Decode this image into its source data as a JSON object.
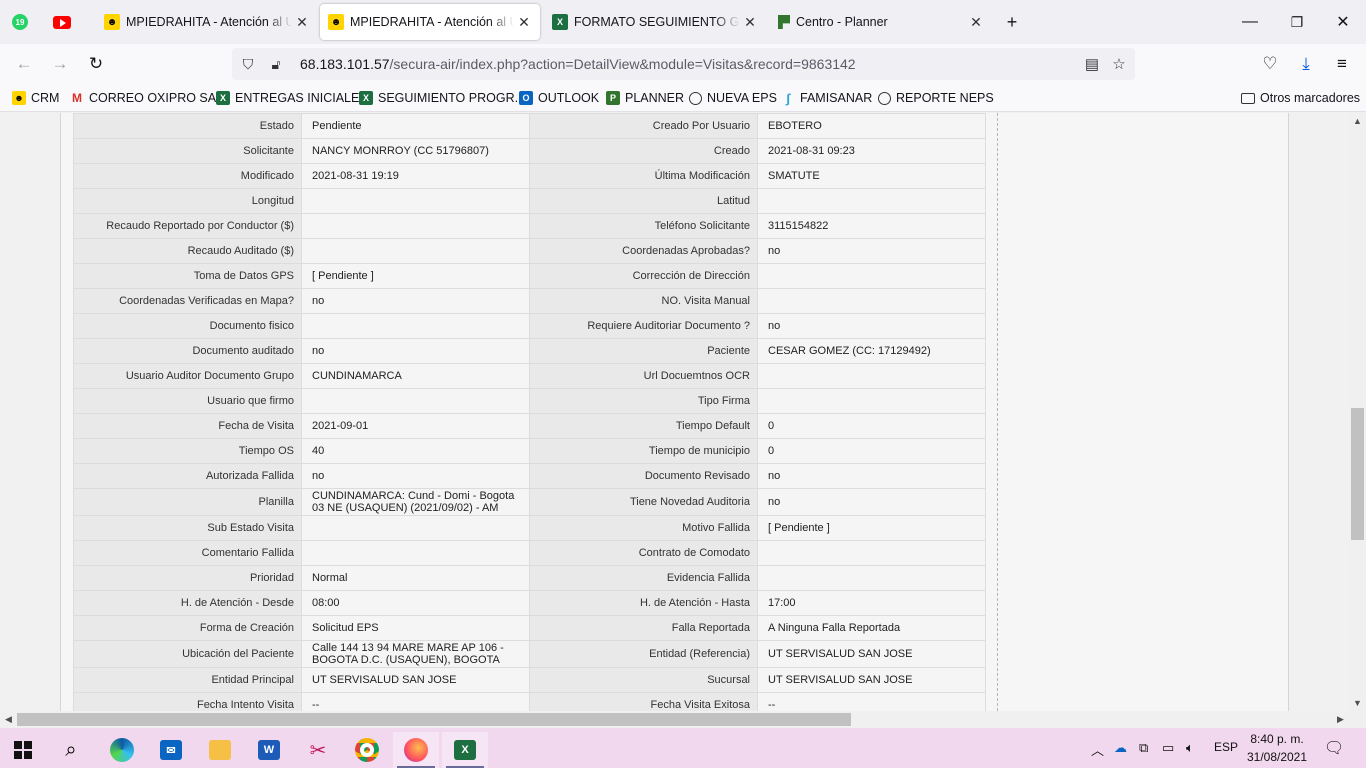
{
  "browser": {
    "pinned": [
      {
        "name": "whatsapp",
        "badge": "19"
      },
      {
        "name": "youtube"
      }
    ],
    "tabs": [
      {
        "title": "MPIEDRAHITA - Atención al Usuario",
        "active": false
      },
      {
        "title": "MPIEDRAHITA - Atención al Usuario",
        "active": true
      },
      {
        "title": "FORMATO SEGUIMIENTO GD.xlsx",
        "active": false
      },
      {
        "title": "Centro - Planner",
        "active": false
      }
    ],
    "url_host": "68.183.101.57",
    "url_path": "/secura-air/index.php?action=DetailView&module=Visitas&record=9863142",
    "bookmarks": [
      {
        "label": "CRM",
        "icon": "crm-icon"
      },
      {
        "label": "CORREO OXIPRO SAS",
        "icon": "gmail-icon"
      },
      {
        "label": "ENTREGAS INICIALES",
        "icon": "excel-icon"
      },
      {
        "label": "SEGUIMIENTO PROGR...",
        "icon": "excel-icon"
      },
      {
        "label": "OUTLOOK",
        "icon": "outlook-icon"
      },
      {
        "label": "PLANNER",
        "icon": "planner-icon"
      },
      {
        "label": "NUEVA EPS",
        "icon": "globe-icon"
      },
      {
        "label": "FAMISANAR",
        "icon": "famisanar-icon"
      },
      {
        "label": "REPORTE NEPS",
        "icon": "globe-icon"
      }
    ],
    "other_bookmarks": "Otros marcadores"
  },
  "detail": {
    "rows": [
      {
        "l1": "Estado",
        "v1": "Pendiente",
        "l2": "Creado Por Usuario",
        "v2": "EBOTERO"
      },
      {
        "l1": "Solicitante",
        "v1": "NANCY MONRROY (CC 51796807)",
        "l2": "Creado",
        "v2": "2021-08-31 09:23"
      },
      {
        "l1": "Modificado",
        "v1": "2021-08-31 19:19",
        "l2": "Última Modificación",
        "v2": " SMATUTE"
      },
      {
        "l1": "Longitud",
        "v1": "",
        "l2": "Latitud",
        "v2": ""
      },
      {
        "l1": "Recaudo Reportado por Conductor ($)",
        "v1": "",
        "l2": "Teléfono Solicitante",
        "v2": "3115154822"
      },
      {
        "l1": "Recaudo Auditado ($)",
        "v1": "",
        "l2": "Coordenadas Aprobadas?",
        "v2": " no"
      },
      {
        "l1": "Toma de Datos GPS",
        "v1": "[ Pendiente ]",
        "l2": "Corrección de Dirección",
        "v2": ""
      },
      {
        "l1": "Coordenadas Verificadas en Mapa?",
        "v1": " no",
        "l2": "NO. Visita Manual",
        "v2": ""
      },
      {
        "l1": "Documento fisico",
        "v1": "",
        "l2": "Requiere Auditoriar Documento ?",
        "v2": " no"
      },
      {
        "l1": "Documento auditado",
        "v1": " no",
        "l2": "Paciente",
        "v2": "CESAR GOMEZ (CC: 17129492)"
      },
      {
        "l1": "Usuario Auditor Documento Grupo",
        "v1": "CUNDINAMARCA",
        "l2": "Url Docuemtnos OCR",
        "v2": ""
      },
      {
        "l1": "Usuario que firmo",
        "v1": "",
        "l2": "Tipo Firma",
        "v2": ""
      },
      {
        "l1": "Fecha de Visita",
        "v1": " 2021-09-01",
        "l2": "Tiempo Default",
        "v2": "0"
      },
      {
        "l1": "Tiempo OS",
        "v1": "40",
        "l2": "Tiempo de municipio",
        "v2": "0"
      },
      {
        "l1": "Autorizada Fallida",
        "v1": " no",
        "l2": "Documento Revisado",
        "v2": " no"
      },
      {
        "l1": "Planilla",
        "v1": "CUNDINAMARCA: Cund - Domi - Bogota 03 NE (USAQUEN) (2021/09/02) - AM",
        "l2": "Tiene Novedad Auditoria",
        "v2": " no"
      },
      {
        "l1": "Sub Estado Visita",
        "v1": "",
        "l2": "Motivo Fallida",
        "v2": "[ Pendiente ]"
      },
      {
        "l1": "Comentario Fallida",
        "v1": "",
        "l2": "Contrato de Comodato",
        "v2": ""
      },
      {
        "l1": "Prioridad",
        "v1": "Normal",
        "l2": "Evidencia Fallida",
        "v2": ""
      },
      {
        "l1": "H. de Atención - Desde",
        "v1": "08:00",
        "l2": "H. de Atención - Hasta",
        "v2": "17:00"
      },
      {
        "l1": "Forma de Creación",
        "v1": "Solicitud EPS",
        "l2": "Falla Reportada",
        "v2": "A Ninguna Falla Reportada"
      },
      {
        "l1": "Ubicación del Paciente",
        "v1": "Calle 144 13 94 MARE MARE AP 106 - BOGOTA D.C. (USAQUEN), BOGOTA",
        "l2": "Entidad (Referencia)",
        "v2": "UT SERVISALUD SAN JOSE"
      },
      {
        "l1": "Entidad Principal",
        "v1": "UT SERVISALUD SAN JOSE",
        "l2": "Sucursal",
        "v2": "UT SERVISALUD SAN JOSE"
      },
      {
        "l1": "Fecha Intento Visita",
        "v1": " --",
        "l2": "Fecha Visita Exitosa",
        "v2": " --"
      }
    ]
  },
  "taskbar": {
    "apps": [
      "start-icon",
      "search-icon",
      "edge-icon",
      "mail-icon",
      "file-explorer-icon",
      "word-icon",
      "snipping-icon",
      "chrome-icon",
      "firefox-icon",
      "excel-icon"
    ],
    "lang": "ESP",
    "time": "8:40 p. m.",
    "date": "31/08/2021"
  }
}
